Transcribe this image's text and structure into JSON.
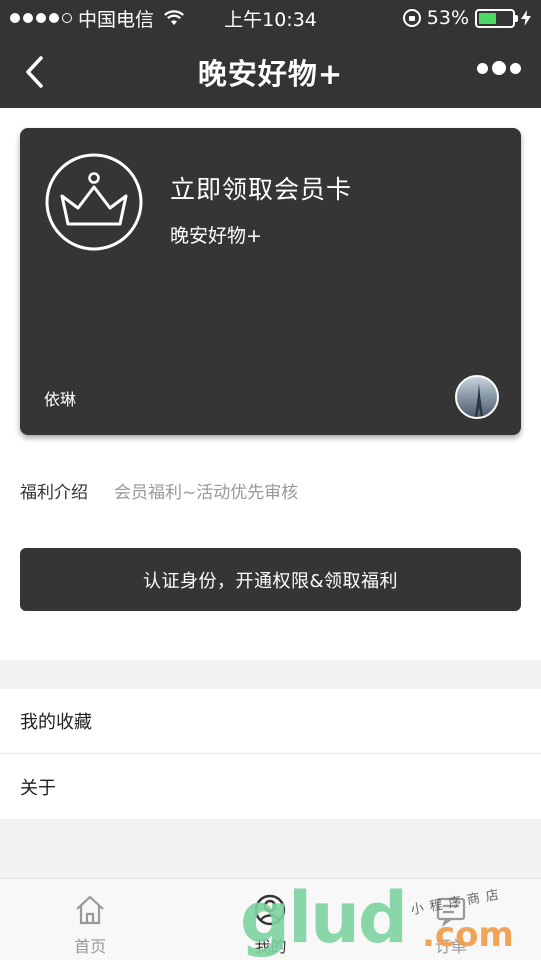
{
  "status_bar": {
    "carrier": "中国电信",
    "time": "上午10:34",
    "battery_percent": "53%",
    "battery_level": 0.53,
    "battery_color": "#4cd964"
  },
  "nav": {
    "title": "晚安好物+",
    "back_icon": "chevron-left-icon",
    "more_icon": "more-dots-icon"
  },
  "card": {
    "title": "立即领取会员卡",
    "subtitle": "晚安好物+",
    "owner": "依琳",
    "badge_icon": "crown-icon",
    "background": "#353535"
  },
  "benefit": {
    "label": "福利介绍",
    "value": "会员福利~活动优先审核"
  },
  "verify_button": {
    "label": "认证身份，开通权限&领取福利"
  },
  "menu": {
    "items": [
      {
        "label": "我的收藏"
      },
      {
        "label": "关于"
      }
    ]
  },
  "tabs": [
    {
      "label": "首页",
      "icon": "home-icon",
      "active": false
    },
    {
      "label": "我的",
      "icon": "user-icon",
      "active": true
    },
    {
      "label": "订单",
      "icon": "order-icon",
      "active": false
    }
  ],
  "watermark": {
    "brand": "glud",
    "domain": ".com",
    "tag": "小程序商店"
  }
}
